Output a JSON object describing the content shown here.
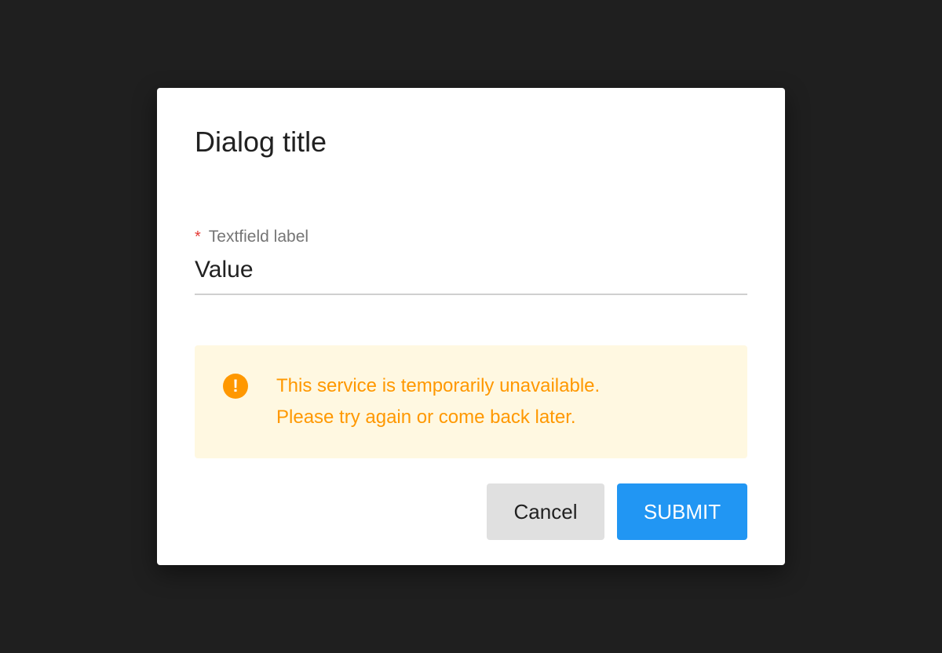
{
  "dialog": {
    "title": "Dialog title",
    "field": {
      "required_mark": "*",
      "label": "Textfield label",
      "value": "Value"
    },
    "alert": {
      "icon": "!",
      "icon_name": "exclamation-circle-icon",
      "line1": "This service is temporarily unavailable.",
      "line2": "Please try again or come back later."
    },
    "actions": {
      "cancel_label": "Cancel",
      "submit_label": "SUBMIT"
    }
  },
  "colors": {
    "backdrop": "#1f1f1f",
    "dialog_bg": "#ffffff",
    "required": "#e53935",
    "warning": "#ff9800",
    "warning_bg": "#fff8e1",
    "primary": "#2196f3",
    "cancel_bg": "#e0e0e0"
  }
}
